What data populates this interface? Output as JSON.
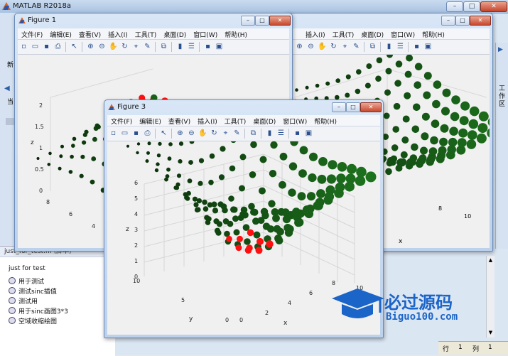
{
  "app": {
    "title": "MATLAB R2018a"
  },
  "main_partial_labels": {
    "left1": "新",
    "left2": "当",
    "right_tab": "工作区"
  },
  "menu": [
    "文件(F)",
    "编辑(E)",
    "查看(V)",
    "插入(I)",
    "工具(T)",
    "桌面(D)",
    "窗口(W)",
    "帮助(H)"
  ],
  "menu_partial_fig2": [
    "插入(I)",
    "工具(T)",
    "桌面(D)",
    "窗口(W)",
    "帮助(H)"
  ],
  "figures": {
    "fig1": {
      "title": "Figure 1",
      "zlabel": "z",
      "zticks": [
        "0",
        "0.5",
        "1",
        "1.5",
        "2"
      ],
      "yticks": [
        "8",
        "6",
        "4"
      ]
    },
    "fig2": {
      "title": "Figure 2 (partially hidden)",
      "xlabel": "x",
      "xticks": [
        "10",
        "8",
        "6"
      ]
    },
    "fig3": {
      "title": "Figure 3",
      "zlabel": "z",
      "ylabel": "y",
      "xlabel": "x",
      "zticks": [
        "0",
        "1",
        "2",
        "3",
        "4",
        "5",
        "6"
      ],
      "yticks": [
        "10",
        "5",
        "0"
      ],
      "xticks": [
        "0",
        "2",
        "4",
        "6",
        "8",
        "10"
      ]
    }
  },
  "left_panel": {
    "header": "just_for_test.m  (脚本)",
    "lines": [
      "just for test",
      "用于测试",
      "测试sinc插值",
      "测试用",
      "用于sinc画图3*3",
      "空域收缩绘图"
    ]
  },
  "status": {
    "row_label": "行",
    "row": "1",
    "col_label": "列",
    "col": "1"
  },
  "watermark": {
    "cn": "必过源码",
    "url": "Biguo100.com"
  },
  "colors": {
    "point_dark": "#0a2a0a",
    "point_green": "#1f7a1f",
    "point_red": "#ff1010",
    "canvas": "#f0f0f0"
  }
}
